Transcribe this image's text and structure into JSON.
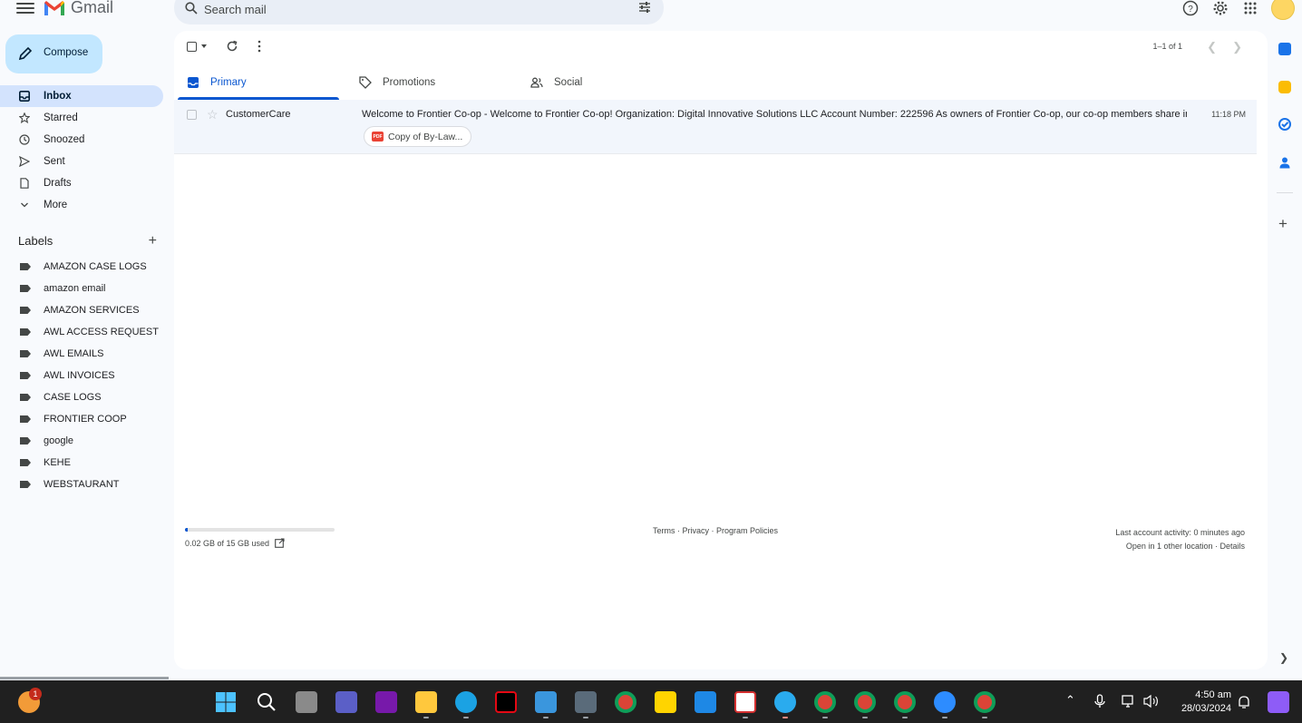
{
  "app": {
    "name": "Gmail"
  },
  "search": {
    "placeholder": "Search mail"
  },
  "compose": {
    "label": "Compose"
  },
  "nav": [
    {
      "label": "Inbox",
      "icon": "inbox-icon",
      "active": true
    },
    {
      "label": "Starred",
      "icon": "star-icon"
    },
    {
      "label": "Snoozed",
      "icon": "clock-icon"
    },
    {
      "label": "Sent",
      "icon": "send-icon"
    },
    {
      "label": "Drafts",
      "icon": "draft-icon"
    },
    {
      "label": "More",
      "icon": "chevron-down-icon"
    }
  ],
  "labels": {
    "heading": "Labels",
    "items": [
      "AMAZON CASE LOGS",
      "amazon email",
      "AMAZON SERVICES",
      "AWL ACCESS REQUEST",
      "AWL EMAILS",
      "AWL INVOICES",
      "CASE LOGS",
      "FRONTIER COOP",
      "google",
      "KEHE",
      "WEBSTAURANT"
    ]
  },
  "toolbar": {
    "pagination": "1–1 of 1"
  },
  "tabs": [
    {
      "label": "Primary",
      "icon": "inbox-icon",
      "active": true
    },
    {
      "label": "Promotions",
      "icon": "tag-icon"
    },
    {
      "label": "Social",
      "icon": "people-icon"
    }
  ],
  "emails": [
    {
      "sender": "CustomerCare",
      "subject": "Welcome to Frontier Co-op - Welcome to Frontier Co-op! Organization: Digital Innovative Solutions LLC Account Number: 222596 As owners of Frontier Co-op, our co-op members share in ...",
      "time": "11:18 PM",
      "attachment": "Copy of By-Law...",
      "attachment_type": "PDF"
    }
  ],
  "footer": {
    "storage": "0.02 GB of 15 GB used",
    "storage_fraction": 0.0013,
    "policies": "Terms · Privacy · Program Policies",
    "activity": "Last account activity: 0 minutes ago",
    "other_location": "Open in 1 other location · Details"
  },
  "taskbar": {
    "weather_badge": "1",
    "time": "4:50 am",
    "date": "28/03/2024"
  },
  "colors": {
    "accent": "#0b57d0",
    "compose_bg": "#c2e7ff",
    "active_nav_bg": "#d3e3fd",
    "row_bg": "#f2f6fc",
    "taskbar_bg": "#202020"
  }
}
